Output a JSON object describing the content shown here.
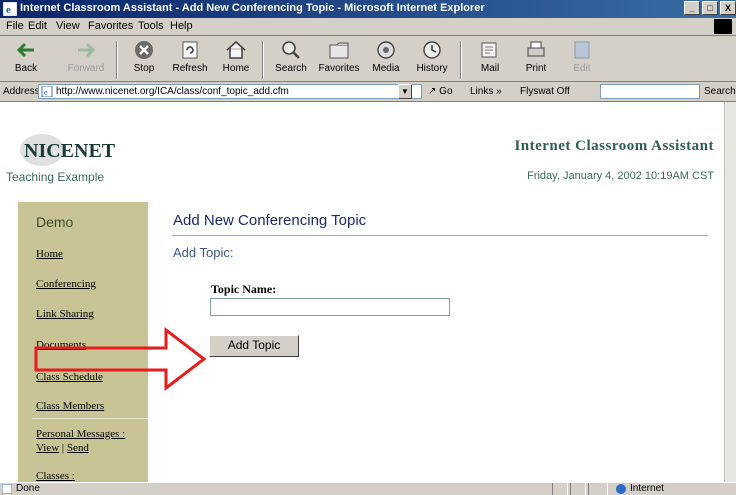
{
  "window": {
    "title": "Internet Classroom Assistant - Add New Conferencing Topic - Microsoft Internet Explorer",
    "buttons": [
      "_",
      "□",
      "X"
    ]
  },
  "menu": [
    "File",
    "Edit",
    "View",
    "Favorites",
    "Tools",
    "Help"
  ],
  "toolbar": {
    "back": "Back",
    "forward": "Forward",
    "stop": "Stop",
    "refresh": "Refresh",
    "home": "Home",
    "search": "Search",
    "favorites": "Favorites",
    "media": "Media",
    "history": "History",
    "mail": "Mail",
    "print": "Print",
    "edit": "Edit"
  },
  "address_bar": {
    "label": "Address",
    "url": "http://www.nicenet.org/ICA/class/conf_topic_add.cfm",
    "go": "Go",
    "links": "Links »",
    "flyswat": "Flyswat Off",
    "search": "Search!"
  },
  "page": {
    "logo_text": "NICENET",
    "course_name": "Teaching Example",
    "app_name": "Internet Classroom Assistant",
    "date": "Friday, January 4, 2002 10:19AM CST",
    "sidebar": {
      "title": "Demo",
      "links": [
        "Home",
        "Conferencing",
        "Link Sharing",
        "Documents",
        "Class Schedule",
        "Class Members"
      ],
      "personal_messages": "Personal Messages :",
      "view": "View",
      "send": "Send",
      "classes": "Classes :"
    },
    "heading": "Add New Conferencing Topic",
    "subheading": "Add Topic:",
    "topic_label": "Topic Name:",
    "topic_value": "",
    "submit_label": "Add Topic"
  },
  "status": {
    "text": "Done",
    "zone": "Internet"
  },
  "colors": {
    "titlebar": "#0a246a",
    "sidebar": "#c8c496",
    "heading": "#1a2a6a",
    "arrow": "#e81c1c"
  }
}
